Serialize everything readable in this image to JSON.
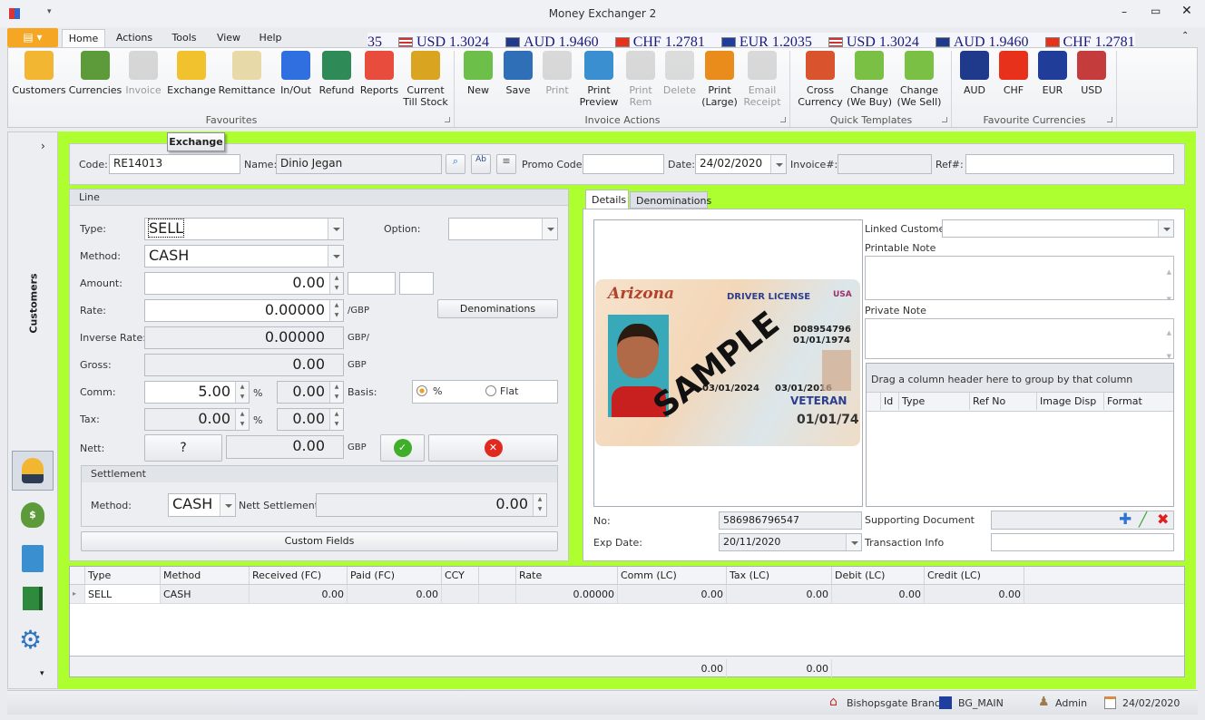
{
  "window": {
    "title": "Money Exchanger 2"
  },
  "ribbon": {
    "tabs": [
      "Home",
      "Actions",
      "Tools",
      "View",
      "Help"
    ],
    "ticker": [
      {
        "flag": "usd",
        "text": "USD 1.3024"
      },
      {
        "flag": "aud",
        "text": "AUD 1.9460"
      },
      {
        "flag": "chf",
        "text": "CHF 1.2781"
      },
      {
        "flag": "eur",
        "text": "EUR 1.2035"
      },
      {
        "flag": "usd",
        "text": "USD 1.3024"
      },
      {
        "flag": "aud",
        "text": "AUD 1.9460"
      },
      {
        "flag": "chf",
        "text": "CHF 1.2781"
      }
    ],
    "ticker_lead": "35",
    "groups": [
      {
        "label": "Favourites",
        "buttons": [
          {
            "label": "Customers",
            "icon": "customer-icon",
            "color": "#f2b632",
            "enabled": true
          },
          {
            "label": "Currencies",
            "icon": "money-bag-icon",
            "color": "#5d9b3a",
            "enabled": true
          },
          {
            "label": "Invoice",
            "icon": "invoice-icon",
            "color": "#b9b9b9",
            "enabled": false
          },
          {
            "label": "Exchange",
            "icon": "exchange-icon",
            "color": "#f2c12e",
            "enabled": true
          },
          {
            "label": "Remittance",
            "icon": "envelope-icon",
            "color": "#e8d9a8",
            "enabled": true
          },
          {
            "label": "In/Out",
            "icon": "arrows-icon",
            "color": "#2f6fe0",
            "enabled": true
          },
          {
            "label": "Refund",
            "icon": "refund-icon",
            "color": "#2e8b57",
            "enabled": true
          },
          {
            "label": "Reports",
            "icon": "chart-icon",
            "color": "#e84c3d",
            "enabled": true
          },
          {
            "label": "Current\nTill Stock",
            "icon": "coins-icon",
            "color": "#d9a521",
            "enabled": true
          }
        ]
      },
      {
        "label": "Invoice Actions",
        "buttons": [
          {
            "label": "New",
            "icon": "new-icon",
            "color": "#6cc04a",
            "enabled": true
          },
          {
            "label": "Save",
            "icon": "save-icon",
            "color": "#2e6fb7",
            "enabled": true
          },
          {
            "label": "Print",
            "icon": "print-icon",
            "color": "#bdbdbd",
            "enabled": false
          },
          {
            "label": "Print\nPreview",
            "icon": "print-preview-icon",
            "color": "#3a8fd0",
            "enabled": true
          },
          {
            "label": "Print\nRem",
            "icon": "print-icon",
            "color": "#bdbdbd",
            "enabled": false
          },
          {
            "label": "Delete",
            "icon": "delete-icon",
            "color": "#c3c3c3",
            "enabled": false
          },
          {
            "label": "Print\n(Large)",
            "icon": "print-large-icon",
            "color": "#e98c1c",
            "enabled": true
          },
          {
            "label": "Email\nReceipt",
            "icon": "email-icon",
            "color": "#bdbdbd",
            "enabled": false
          }
        ]
      },
      {
        "label": "Quick Templates",
        "buttons": [
          {
            "label": "Cross\nCurrency",
            "icon": "cross-currency-icon",
            "color": "#d9532c",
            "enabled": true
          },
          {
            "label": "Change\n(We Buy)",
            "icon": "arrow-down-icon",
            "color": "#79c045",
            "enabled": true
          },
          {
            "label": "Change\n(We Sell)",
            "icon": "arrow-up-icon",
            "color": "#79c045",
            "enabled": true
          }
        ]
      },
      {
        "label": "Favourite Currencies",
        "buttons": [
          {
            "label": "AUD",
            "icon": "flag-aud-icon",
            "color": "#1f3a8a",
            "enabled": true
          },
          {
            "label": "CHF",
            "icon": "flag-chf-icon",
            "color": "#e8311a",
            "enabled": true
          },
          {
            "label": "EUR",
            "icon": "flag-eur-icon",
            "color": "#1f3d99",
            "enabled": true
          },
          {
            "label": "USD",
            "icon": "flag-usd-icon",
            "color": "#c43c3c",
            "enabled": true
          }
        ]
      }
    ]
  },
  "tooltip": "Exchange",
  "sidebar": {
    "title": "Customers"
  },
  "header": {
    "code_label": "Code:",
    "code": "RE14013",
    "name_label": "Name:",
    "name": "Dinio Jegan",
    "promo_label": "Promo Code:",
    "promo": "",
    "date_label": "Date:",
    "date": "24/02/2020",
    "invoice_label": "Invoice#:",
    "invoice": "",
    "ref_label": "Ref#:",
    "ref": ""
  },
  "line": {
    "title": "Line",
    "type_label": "Type:",
    "type": "SELL",
    "option_label": "Option:",
    "option": "",
    "method_label": "Method:",
    "method": "CASH",
    "amount_label": "Amount:",
    "amount": "0.00",
    "rate_label": "Rate:",
    "rate": "0.00000",
    "rate_unit": "/GBP",
    "denominations": "Denominations",
    "inverse_label": "Inverse Rate:",
    "inverse": "0.00000",
    "inverse_unit": "GBP/",
    "gross_label": "Gross:",
    "gross": "0.00",
    "gross_unit": "GBP",
    "comm_label": "Comm:",
    "comm": "5.00",
    "comm_pct": "%",
    "comm_value": "0.00",
    "basis_label": "Basis:",
    "basis_options": [
      "%",
      "Flat"
    ],
    "basis_selected": "%",
    "tax_label": "Tax:",
    "tax": "0.00",
    "tax_pct": "%",
    "tax_value": "0.00",
    "nett_label": "Nett:",
    "nett_q": "?",
    "nett": "0.00",
    "nett_unit": "GBP",
    "settlement": {
      "title": "Settlement",
      "method_label": "Method:",
      "method": "CASH",
      "nett_label": "Nett Settlement:",
      "nett": "0.00"
    },
    "custom_fields": "Custom Fields"
  },
  "details": {
    "tabs": [
      "Details",
      "Denominations"
    ],
    "no_label": "No:",
    "no": "586986796547",
    "exp_label": "Exp Date:",
    "exp": "20/11/2020",
    "linked_label": "Linked Customer",
    "printable_label": "Printable Note",
    "private_label": "Private Note",
    "group_hint": "Drag a column header here to group by that column",
    "doc_columns": [
      "Id",
      "Type",
      "Ref No",
      "Image Disp",
      "Format"
    ],
    "supporting_label": "Supporting Document",
    "transaction_label": "Transaction Info",
    "card": {
      "state": "Arizona",
      "title": "DRIVER LICENSE",
      "country": "USA",
      "watermark": "SAMPLE",
      "dl": "D08954796",
      "dob": "01/01/1974",
      "exp": "03/01/2024",
      "iss": "03/01/2016",
      "veteran": "VETERAN",
      "date": "01/01/74"
    }
  },
  "grid": {
    "columns": [
      "Type",
      "Method",
      "Received (FC)",
      "Paid (FC)",
      "CCY",
      "",
      "Rate",
      "Comm (LC)",
      "Tax (LC)",
      "Debit (LC)",
      "Credit (LC)"
    ],
    "rows": [
      [
        "SELL",
        "CASH",
        "0.00",
        "0.00",
        "",
        "",
        "0.00000",
        "0.00",
        "0.00",
        "0.00",
        "0.00"
      ]
    ],
    "totals": {
      "comm": "0.00",
      "tax": "0.00"
    }
  },
  "status": {
    "branch": "Bishopsgate Branch",
    "till": "BG_MAIN",
    "user": "Admin",
    "date": "24/02/2020"
  },
  "colors": {
    "accent_green": "#adff2f",
    "ticker_text": "#1a1a7a",
    "app_button": "#f5a623"
  }
}
